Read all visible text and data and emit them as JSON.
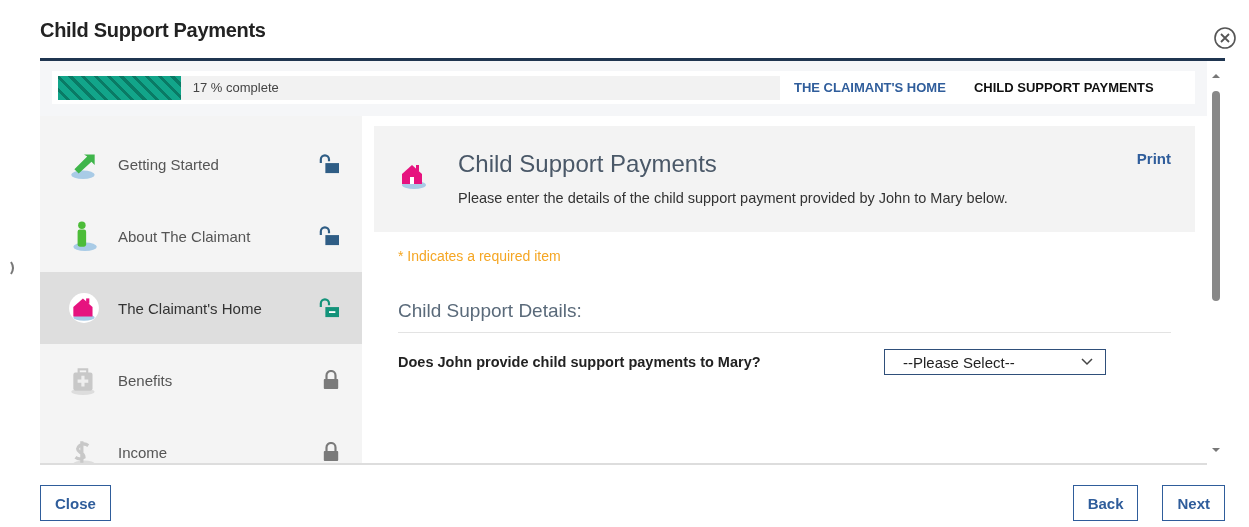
{
  "dialog": {
    "title": "Child Support Payments"
  },
  "progress": {
    "level": 0.17,
    "label": "17 % complete"
  },
  "breadcrumbs": [
    {
      "label": "THE CLAIMANT'S HOME",
      "selected": false
    },
    {
      "label": "CHILD SUPPORT PAYMENTS",
      "selected": true
    }
  ],
  "sidebar": {
    "items": [
      {
        "label": "Getting Started",
        "selected": false,
        "locked": false
      },
      {
        "label": "About The Claimant",
        "selected": false,
        "locked": false
      },
      {
        "label": "The Claimant's Home",
        "selected": true,
        "locked": false
      },
      {
        "label": "Benefits",
        "selected": false,
        "locked": true
      },
      {
        "label": "Income",
        "selected": false,
        "locked": true
      }
    ]
  },
  "page": {
    "title": "Child Support Payments",
    "description": "Please enter the details of the child support payment provided by John to Mary below.",
    "print": "Print",
    "required_note": "* Indicates a required item",
    "section": "Child Support Details:",
    "question": {
      "label": "Does John provide child support payments to Mary?",
      "placeholder": "--Please Select--"
    }
  },
  "footer": {
    "close": "Close",
    "back": "Back",
    "next": "Next"
  }
}
